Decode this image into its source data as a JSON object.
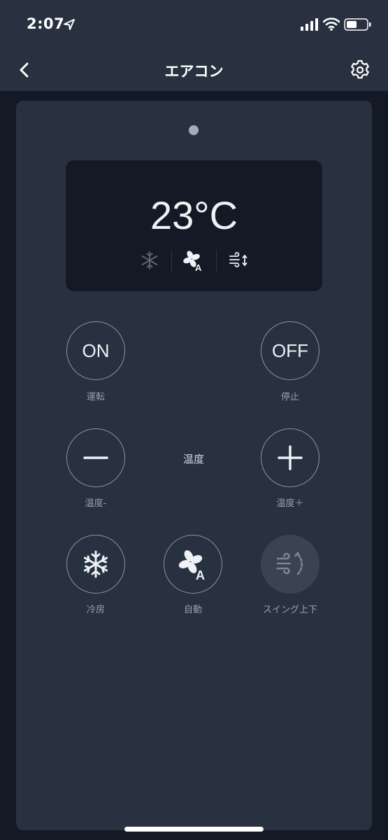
{
  "status_bar": {
    "time": "2:07"
  },
  "nav": {
    "title": "エアコン"
  },
  "display": {
    "temperature": "23°C"
  },
  "buttons": {
    "on": {
      "text": "ON",
      "label": "運転"
    },
    "off": {
      "text": "OFF",
      "label": "停止"
    },
    "temp_down": {
      "label": "温度-"
    },
    "temp_center": "温度",
    "temp_up": {
      "label": "温度＋"
    },
    "cool": {
      "label": "冷房"
    },
    "auto": {
      "label": "自動"
    },
    "swing": {
      "label": "スイング上下"
    }
  },
  "colors": {
    "background": "#131a25",
    "panel": "#283140",
    "accent": "#eef1f5"
  }
}
